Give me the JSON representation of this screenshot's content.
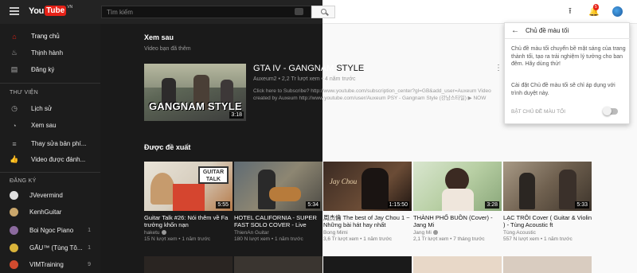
{
  "header": {
    "logo_you": "You",
    "logo_tube": "Tube",
    "logo_region": "VN",
    "search_placeholder": "Tìm kiếm",
    "notification_count": "5"
  },
  "sidebar": {
    "items": [
      {
        "label": "Trang chủ",
        "icon": "home-icon",
        "active": true
      },
      {
        "label": "Thịnh hành",
        "icon": "flame-icon"
      },
      {
        "label": "Đăng ký",
        "icon": "subscriptions-icon"
      }
    ],
    "library_heading": "THƯ VIỆN",
    "library_items": [
      {
        "label": "Lịch sử",
        "icon": "history-icon"
      },
      {
        "label": "Xem sau",
        "icon": "clock-icon"
      },
      {
        "label": "Thay sửa bản phí...",
        "icon": "playlist-icon"
      },
      {
        "label": "Video được đánh...",
        "icon": "thumbs-up-icon"
      }
    ],
    "subs_heading": "ĐĂNG KÝ",
    "subscriptions": [
      {
        "label": "JVevermind",
        "count": ""
      },
      {
        "label": "KenhGuitar",
        "count": ""
      },
      {
        "label": "Boi Ngoc Piano",
        "count": "1"
      },
      {
        "label": "GẤU™ (Tùng Tô...",
        "count": "1"
      },
      {
        "label": "VIMTraining",
        "count": "9"
      }
    ]
  },
  "watch_later": {
    "title": "Xem sau",
    "subtitle": "Video bạn đã thêm",
    "video": {
      "title_dark": "GTA IV - GANGNAM ",
      "title_light": "STYLE",
      "meta": "Auxeum2 • 2,2 Tr lượt xem • 4 năm trước",
      "desc1": "Click here to Subscribe? http://www.youtube.com/subscription_center?gl=GB&add_user=Auxeum Video",
      "desc2": "created by Auxeum http://www.youtube.com/user/Auxeum PSY - Gangnam Style (강남스타일) ▶ NOW",
      "duration": "3:18",
      "thumb_text": "GANGNAM STYLE"
    }
  },
  "recommended": {
    "title": "Được đề xuất",
    "cards": [
      {
        "title": "Guitar Talk #26: Nói thêm về Fa trưởng khốn nạn",
        "channel": "haketu",
        "stats": "15 N lượt xem • 1 năm trước",
        "duration": "5:55",
        "thumb_text": "GUITAR TALK"
      },
      {
        "title": "HOTEL CALIFORNIA - SUPER FAST SOLO COVER - Live",
        "channel": "ThienAn Guitar",
        "stats": "180 N lượt xem • 1 năm trước",
        "duration": "5:34",
        "thumb_text": ""
      },
      {
        "title": "周杰倫 The best of Jay Chou 1 ~ Những bài hát hay nhất",
        "channel": "Bong Mimi",
        "stats": "3,6 Tr lượt xem • 1 năm trước",
        "duration": "1:15:50",
        "thumb_text": "Jay Chou"
      },
      {
        "title": "THÀNH PHỐ BUỒN (Cover) - Jang Mi",
        "channel": "Jang Mi",
        "stats": "2,1 Tr lượt xem • 7 tháng trước",
        "duration": "3:28",
        "thumb_text": ""
      },
      {
        "title": "LẠC TRÔI Cover ( Guitar & Violin ) - Tùng Acoustic ft",
        "channel": "Tùng Acoustic",
        "stats": "557 N lượt xem • 1 năm trước",
        "duration": "5:33",
        "thumb_text": ""
      }
    ]
  },
  "popup": {
    "title": "Chủ đề màu tối",
    "p1": "Chủ đề màu tối chuyển bề mặt sáng của trang thành tối, tạo ra trải nghiệm lý tưởng cho ban đêm. Hãy dùng thử!",
    "p2": "Cài đặt Chủ đề màu tối sẽ chỉ áp dụng với trình duyệt này.",
    "toggle_label": "BẬT CHỦ ĐỀ MÀU TỐI",
    "toggle_on": false
  },
  "colors": {
    "accent": "#e62117",
    "dark_bg": "#1a1a1a",
    "light_bg": "#f9f9f9"
  }
}
